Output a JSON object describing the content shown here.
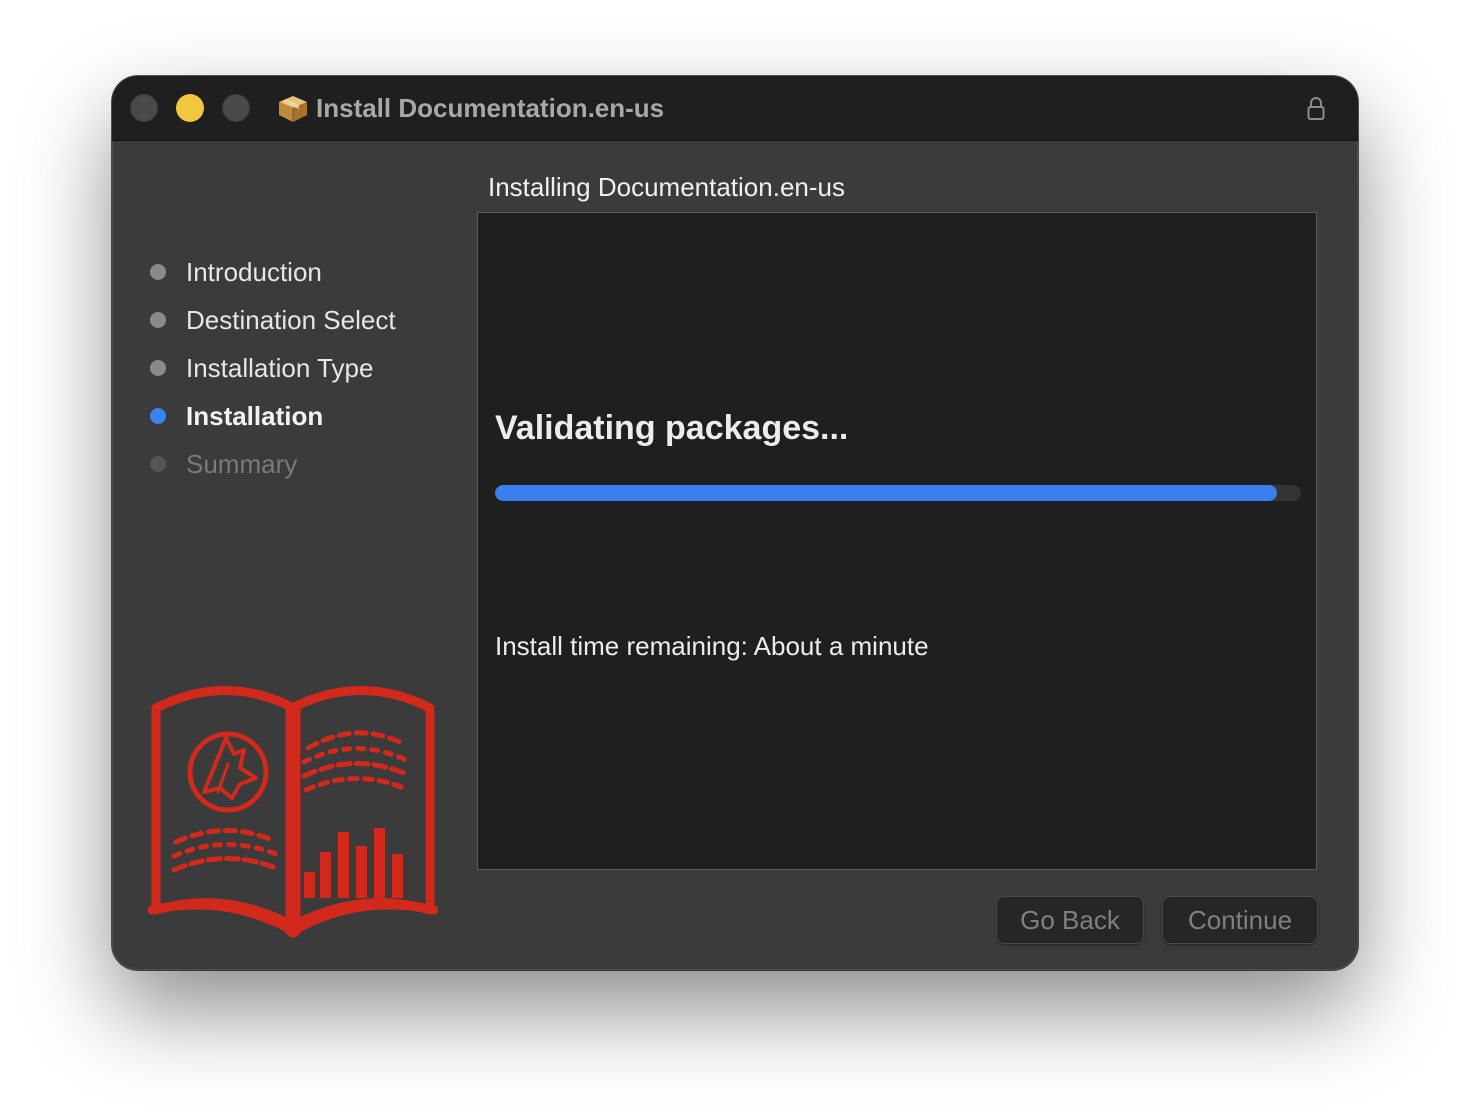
{
  "window": {
    "title": "Install Documentation.en-us",
    "title_icon": "package-box-icon",
    "lock_icon": "lock-icon"
  },
  "sidebar": {
    "steps": [
      {
        "label": "Introduction",
        "state": "done"
      },
      {
        "label": "Destination Select",
        "state": "done"
      },
      {
        "label": "Installation Type",
        "state": "done"
      },
      {
        "label": "Installation",
        "state": "current"
      },
      {
        "label": "Summary",
        "state": "upcoming"
      }
    ],
    "logo_icon": "book-fox-chart-logo",
    "logo_color": "#d2291c"
  },
  "main": {
    "heading": "Installing Documentation.en-us",
    "status": "Validating packages...",
    "progress": 0.97,
    "time_remaining": "Install time remaining: About a minute"
  },
  "buttons": {
    "back": "Go Back",
    "continue": "Continue"
  },
  "colors": {
    "accent": "#3a7ff0",
    "minimize": "#f3c73d"
  }
}
